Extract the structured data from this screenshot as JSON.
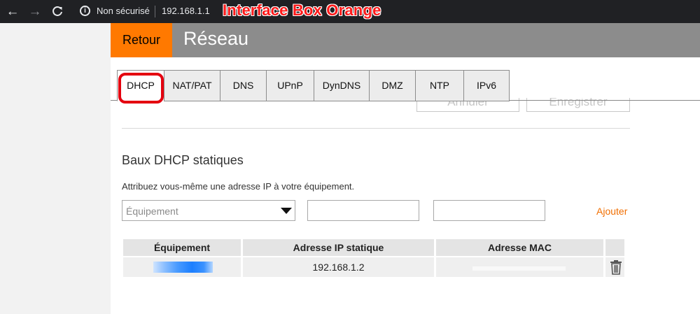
{
  "browser": {
    "security_label": "Non sécurisé",
    "url": "192.168.1.1",
    "info_glyph": "i",
    "back_glyph": "←",
    "forward_glyph": "→",
    "reload_glyph": "C"
  },
  "annotation": {
    "title": "Interface Box Orange",
    "highlight_color": "#e4000f"
  },
  "header": {
    "back_label": "Retour",
    "title": "Réseau",
    "accent_color": "#ff7900"
  },
  "tabs": [
    {
      "label": "DHCP",
      "active": true
    },
    {
      "label": "NAT/PAT",
      "active": false
    },
    {
      "label": "DNS",
      "active": false
    },
    {
      "label": "UPnP",
      "active": false
    },
    {
      "label": "DynDNS",
      "active": false
    },
    {
      "label": "DMZ",
      "active": false
    },
    {
      "label": "NTP",
      "active": false
    },
    {
      "label": "IPv6",
      "active": false
    }
  ],
  "form_actions": {
    "cancel_label": "Annuler",
    "save_label": "Enregistrer"
  },
  "static_leases": {
    "title": "Baux DHCP statiques",
    "description": "Attribuez vous-même une adresse IP à votre équipement.",
    "device_select_placeholder": "Équipement",
    "ip_value": "",
    "mac_value": "",
    "add_label": "Ajouter",
    "columns": [
      "Équipement",
      "Adresse IP statique",
      "Adresse MAC"
    ],
    "rows": [
      {
        "device": "",
        "ip": "192.168.1.2",
        "mac": ""
      }
    ]
  },
  "icons": {
    "info": "info-icon",
    "delete": "trash-icon",
    "dropdown": "dropdown-arrow-icon"
  }
}
